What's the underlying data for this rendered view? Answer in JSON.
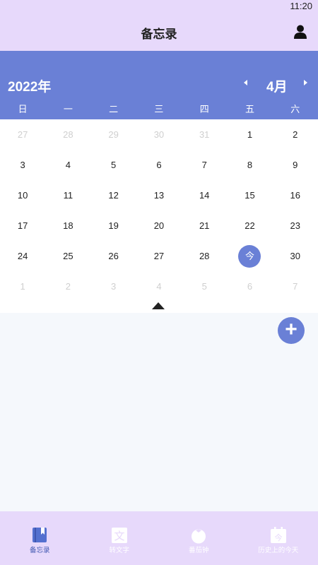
{
  "status_bar": {
    "time": "11:20"
  },
  "header": {
    "title": "备忘录"
  },
  "calendar": {
    "year": "2022年",
    "month": "4月",
    "weekdays": [
      "日",
      "一",
      "二",
      "三",
      "四",
      "五",
      "六"
    ],
    "weeks": [
      [
        {
          "d": "27",
          "dim": true
        },
        {
          "d": "28",
          "dim": true
        },
        {
          "d": "29",
          "dim": true
        },
        {
          "d": "30",
          "dim": true
        },
        {
          "d": "31",
          "dim": true
        },
        {
          "d": "1"
        },
        {
          "d": "2"
        }
      ],
      [
        {
          "d": "3"
        },
        {
          "d": "4"
        },
        {
          "d": "5"
        },
        {
          "d": "6"
        },
        {
          "d": "7"
        },
        {
          "d": "8"
        },
        {
          "d": "9"
        }
      ],
      [
        {
          "d": "10"
        },
        {
          "d": "11"
        },
        {
          "d": "12"
        },
        {
          "d": "13"
        },
        {
          "d": "14"
        },
        {
          "d": "15"
        },
        {
          "d": "16"
        }
      ],
      [
        {
          "d": "17"
        },
        {
          "d": "18"
        },
        {
          "d": "19"
        },
        {
          "d": "20"
        },
        {
          "d": "21"
        },
        {
          "d": "22"
        },
        {
          "d": "23"
        }
      ],
      [
        {
          "d": "24"
        },
        {
          "d": "25"
        },
        {
          "d": "26"
        },
        {
          "d": "27"
        },
        {
          "d": "28"
        },
        {
          "d": "今",
          "today": true
        },
        {
          "d": "30"
        }
      ],
      [
        {
          "d": "1",
          "dim": true
        },
        {
          "d": "2",
          "dim": true
        },
        {
          "d": "3",
          "dim": true
        },
        {
          "d": "4",
          "dim": true
        },
        {
          "d": "5",
          "dim": true
        },
        {
          "d": "6",
          "dim": true
        },
        {
          "d": "7",
          "dim": true
        }
      ]
    ]
  },
  "fab": {
    "label": "+"
  },
  "tabs": [
    {
      "label": "备忘录",
      "icon": "book-icon",
      "active": true
    },
    {
      "label": "转文字",
      "icon": "text-convert-icon",
      "active": false
    },
    {
      "label": "番茄钟",
      "icon": "tomato-icon",
      "active": false
    },
    {
      "label": "历史上的今天",
      "icon": "calendar-today-icon",
      "active": false
    }
  ],
  "colors": {
    "accent": "#6a80d6",
    "bar": "#e7d9fb",
    "background": "#f5f8fc"
  }
}
